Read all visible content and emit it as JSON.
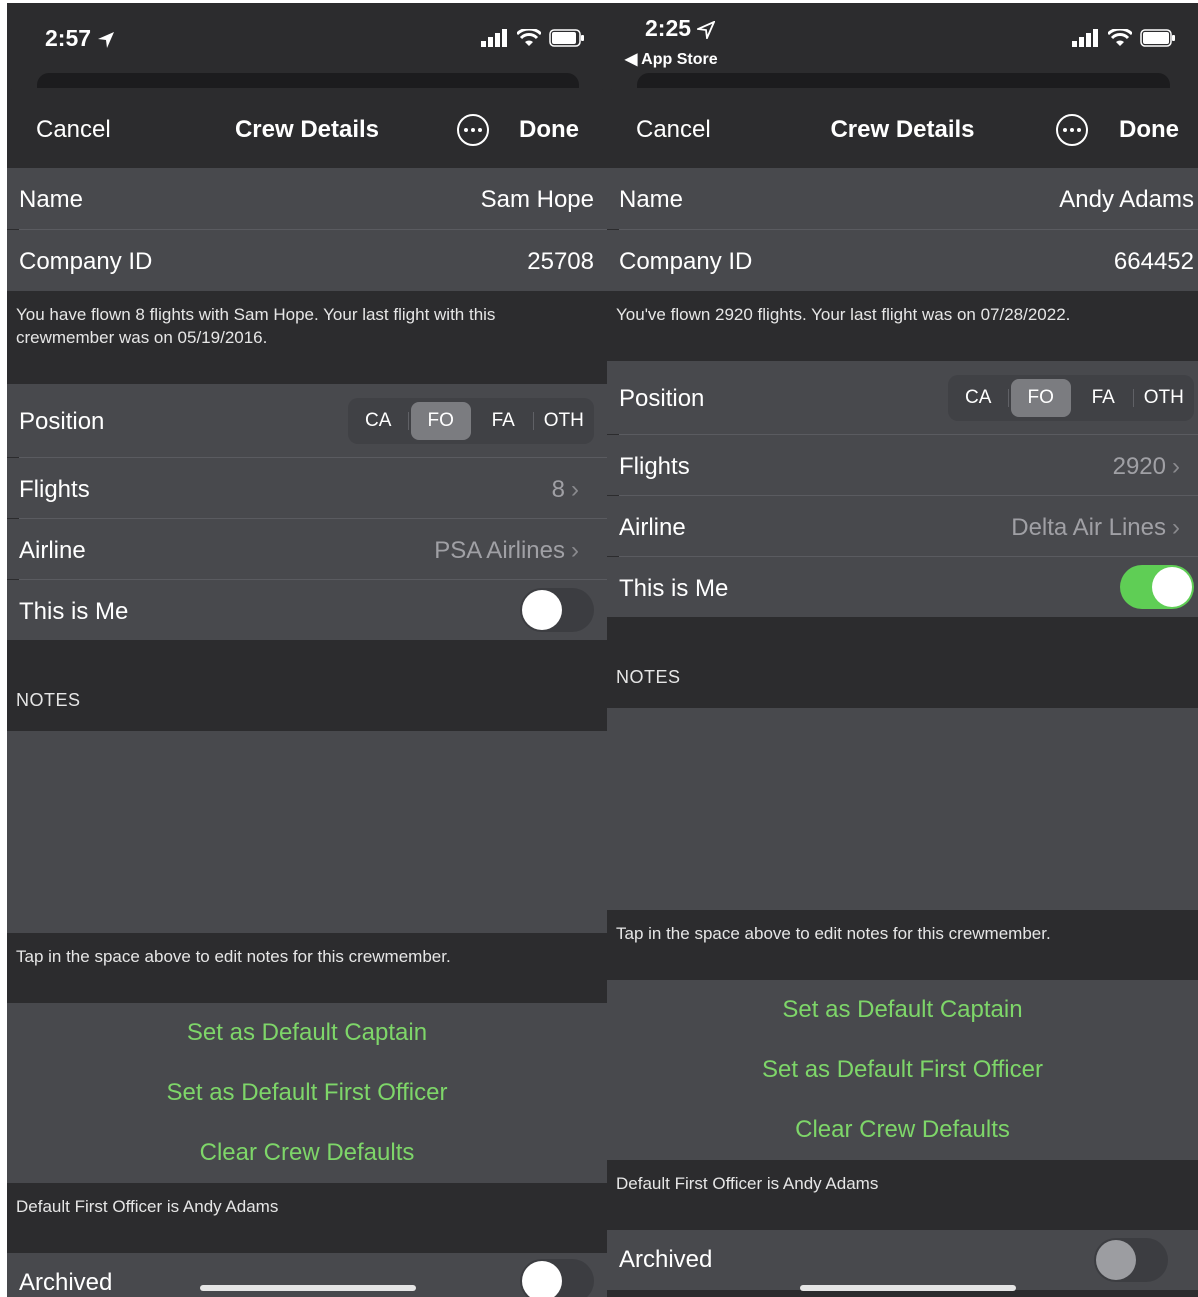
{
  "screens": [
    {
      "status": {
        "time": "2:57",
        "back": ""
      },
      "nav": {
        "cancel": "Cancel",
        "title": "Crew Details",
        "done": "Done"
      },
      "name": {
        "label": "Name",
        "value": "Sam Hope"
      },
      "company_id": {
        "label": "Company ID",
        "value": "25708"
      },
      "history_note": "You have flown 8 flights with Sam Hope. Your last flight with this crewmember was on 05/19/2016.",
      "position": {
        "label": "Position",
        "options": [
          "CA",
          "FO",
          "FA",
          "OTH"
        ],
        "selected": "FO"
      },
      "flights": {
        "label": "Flights",
        "value": "8"
      },
      "airline": {
        "label": "Airline",
        "value": "PSA Airlines"
      },
      "this_is_me": {
        "label": "This is Me",
        "on": false
      },
      "notes_header": "NOTES",
      "notes_hint": "Tap in the space above to edit notes for this crewmember.",
      "buttons": {
        "captain": "Set as Default Captain",
        "first_officer": "Set as Default First Officer",
        "clear": "Clear Crew Defaults"
      },
      "defaults_note": "Default First Officer is Andy Adams",
      "archived": {
        "label": "Archived",
        "on": false
      }
    },
    {
      "status": {
        "time": "2:25",
        "back": "◀ App Store"
      },
      "nav": {
        "cancel": "Cancel",
        "title": "Crew Details",
        "done": "Done"
      },
      "name": {
        "label": "Name",
        "value": "Andy Adams"
      },
      "company_id": {
        "label": "Company ID",
        "value": "664452"
      },
      "history_note": "You've flown 2920 flights. Your last flight was on 07/28/2022.",
      "position": {
        "label": "Position",
        "options": [
          "CA",
          "FO",
          "FA",
          "OTH"
        ],
        "selected": "FO"
      },
      "flights": {
        "label": "Flights",
        "value": "2920"
      },
      "airline": {
        "label": "Airline",
        "value": "Delta Air Lines"
      },
      "this_is_me": {
        "label": "This is Me",
        "on": true
      },
      "notes_header": "NOTES",
      "notes_hint": "Tap in the space above to edit notes for this crewmember.",
      "buttons": {
        "captain": "Set as Default Captain",
        "first_officer": "Set as Default First Officer",
        "clear": "Clear Crew Defaults"
      },
      "defaults_note": "Default First Officer is Andy Adams",
      "archived": {
        "label": "Archived",
        "on": false
      }
    }
  ],
  "colors": {
    "accent_green": "#7ed669",
    "toggle_on": "#5fce55",
    "cell_bg": "#48494d",
    "group_bg": "#2c2c2e"
  }
}
